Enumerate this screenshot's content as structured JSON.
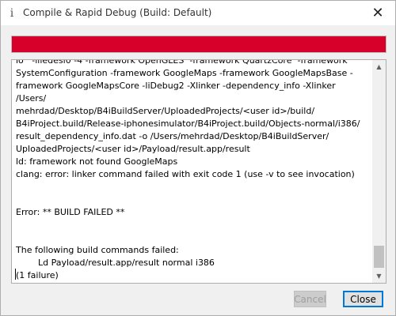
{
  "window": {
    "title": "Compile & Rapid Debug (Build: Default)",
    "app_icon_glyph": "i",
    "close_glyph": "✕",
    "icons": {
      "app": "info-icon",
      "close": "close-icon"
    }
  },
  "progress": {
    "value_percent": 100,
    "fill_color": "#d7002a"
  },
  "log": {
    "text": "lo   -lliedesi0 -4 -framework OpenGLES  -framework QuartzCore  -framework\nSystemConfiguration -framework GoogleMaps -framework GoogleMapsBase -\nframework GoogleMapsCore -liDebug2 -Xlinker -dependency_info -Xlinker /Users/\nmehrdad/Desktop/B4iBuildServer/UploadedProjects/<user id>/build/\nB4iProject.build/Release-iphonesimulator/B4iProject.build/Objects-normal/i386/\nresult_dependency_info.dat -o /Users/mehrdad/Desktop/B4iBuildServer/\nUploadedProjects/<user id>/Payload/result.app/result\nld: framework not found GoogleMaps\nclang: error: linker command failed with exit code 1 (use -v to see invocation)\n\n\nError: ** BUILD FAILED **\n\n\nThe following build commands failed:\n\tLd Payload/result.app/result normal i386\n(1 failure)"
  },
  "scrollbar": {
    "up_glyph": "▲",
    "down_glyph": "▼"
  },
  "buttons": {
    "cancel_label": "Cancel",
    "close_label": "Close"
  }
}
